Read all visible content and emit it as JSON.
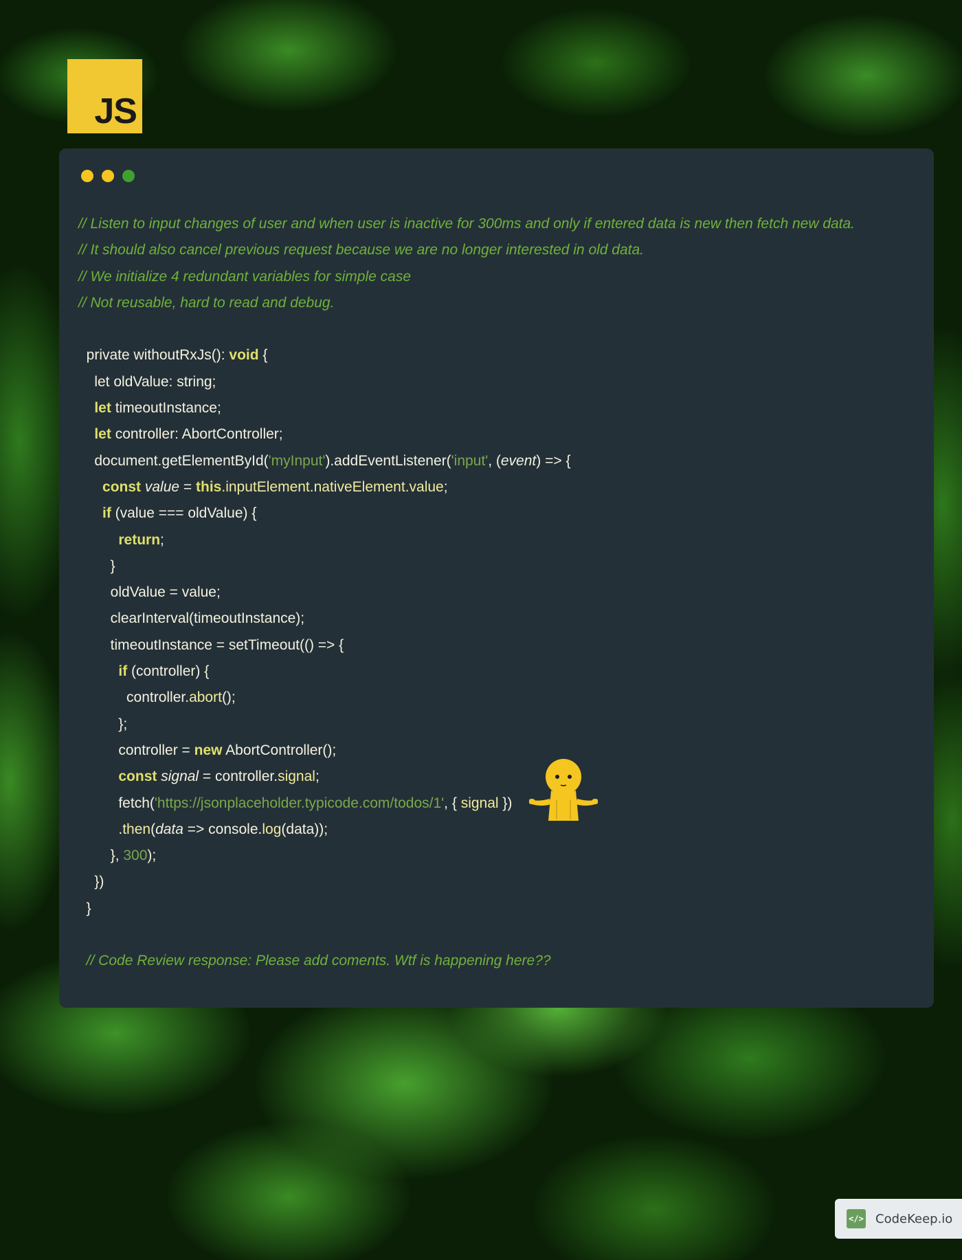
{
  "logo": {
    "text": "JS"
  },
  "window_dots": [
    {
      "name": "yellow",
      "color": "#f5c61f"
    },
    {
      "name": "yellow",
      "color": "#f5c61f"
    },
    {
      "name": "green",
      "color": "#3fa02f"
    }
  ],
  "code_lines": [
    [
      {
        "t": "// Listen to input changes of user and when user is inactive for 300ms and only if entered data is new then fetch new data.",
        "c": "cm"
      }
    ],
    [
      {
        "t": "// It should also cancel previous request because we are no longer interested in old data.",
        "c": "cm"
      }
    ],
    [
      {
        "t": "// We initialize 4 redundant variables for simple case",
        "c": "cm"
      }
    ],
    [
      {
        "t": "// Not reusable, hard to read and debug.",
        "c": "cm"
      }
    ],
    [],
    [
      {
        "t": "  private withoutRxJs(): "
      },
      {
        "t": "void",
        "c": "kw"
      },
      {
        "t": " {"
      }
    ],
    [
      {
        "t": "    let oldValue: string;"
      }
    ],
    [
      {
        "t": "    "
      },
      {
        "t": "let",
        "c": "kw"
      },
      {
        "t": " timeoutInstance;"
      }
    ],
    [
      {
        "t": "    "
      },
      {
        "t": "let",
        "c": "kw"
      },
      {
        "t": " controller: AbortController;"
      }
    ],
    [
      {
        "t": "    document.getElementById("
      },
      {
        "t": "'myInput'",
        "c": "st"
      },
      {
        "t": ").addEventListener("
      },
      {
        "t": "'input'",
        "c": "st"
      },
      {
        "t": ", ("
      },
      {
        "t": "event",
        "c": "it"
      },
      {
        "t": ") => {"
      }
    ],
    [
      {
        "t": "      "
      },
      {
        "t": "const",
        "c": "kw"
      },
      {
        "t": " "
      },
      {
        "t": "value",
        "c": "it"
      },
      {
        "t": " = "
      },
      {
        "t": "this",
        "c": "kw"
      },
      {
        "t": ".inputElement.nativeElement.value",
        "c": "fn"
      },
      {
        "t": ";"
      }
    ],
    [
      {
        "t": "      "
      },
      {
        "t": "if",
        "c": "kw"
      },
      {
        "t": " (value === oldValue) {"
      }
    ],
    [
      {
        "t": "          "
      },
      {
        "t": "return",
        "c": "kw"
      },
      {
        "t": ";"
      }
    ],
    [
      {
        "t": "        }"
      }
    ],
    [
      {
        "t": "        oldValue = value;"
      }
    ],
    [
      {
        "t": "        clearInterval(timeoutInstance);"
      }
    ],
    [
      {
        "t": "        timeoutInstance = setTimeout(() => {"
      }
    ],
    [
      {
        "t": "          "
      },
      {
        "t": "if",
        "c": "kw"
      },
      {
        "t": " (controller) {"
      }
    ],
    [
      {
        "t": "            controller."
      },
      {
        "t": "abort",
        "c": "fn"
      },
      {
        "t": "();"
      }
    ],
    [
      {
        "t": "          };"
      }
    ],
    [
      {
        "t": "          controller = "
      },
      {
        "t": "new",
        "c": "kw"
      },
      {
        "t": " AbortController();"
      }
    ],
    [
      {
        "t": "          "
      },
      {
        "t": "const",
        "c": "kw"
      },
      {
        "t": " "
      },
      {
        "t": "signal",
        "c": "it"
      },
      {
        "t": " = controller."
      },
      {
        "t": "signal",
        "c": "fn"
      },
      {
        "t": ";"
      }
    ],
    [
      {
        "t": "          fetch("
      },
      {
        "t": "'https://jsonplaceholder.typicode.com/todos/1'",
        "c": "st"
      },
      {
        "t": ", { "
      },
      {
        "t": "signal",
        "c": "fn"
      },
      {
        "t": " })"
      }
    ],
    [
      {
        "t": "          ."
      },
      {
        "t": "then",
        "c": "fn"
      },
      {
        "t": "("
      },
      {
        "t": "data",
        "c": "it"
      },
      {
        "t": " => console."
      },
      {
        "t": "log",
        "c": "fn"
      },
      {
        "t": "(data));"
      }
    ],
    [
      {
        "t": "        }, "
      },
      {
        "t": "300",
        "c": "nm"
      },
      {
        "t": ");"
      }
    ],
    [
      {
        "t": "    })"
      }
    ],
    [
      {
        "t": "  }"
      }
    ],
    [],
    [
      {
        "t": "  // Code Review response: Please add coments. Wtf is happening here??",
        "c": "cm"
      }
    ]
  ],
  "mascot": {
    "icon": "shrug-emoji-icon",
    "color": "#f5c61f"
  },
  "badge": {
    "icon": "code-brackets-icon",
    "text": "CodeKeep.io"
  }
}
